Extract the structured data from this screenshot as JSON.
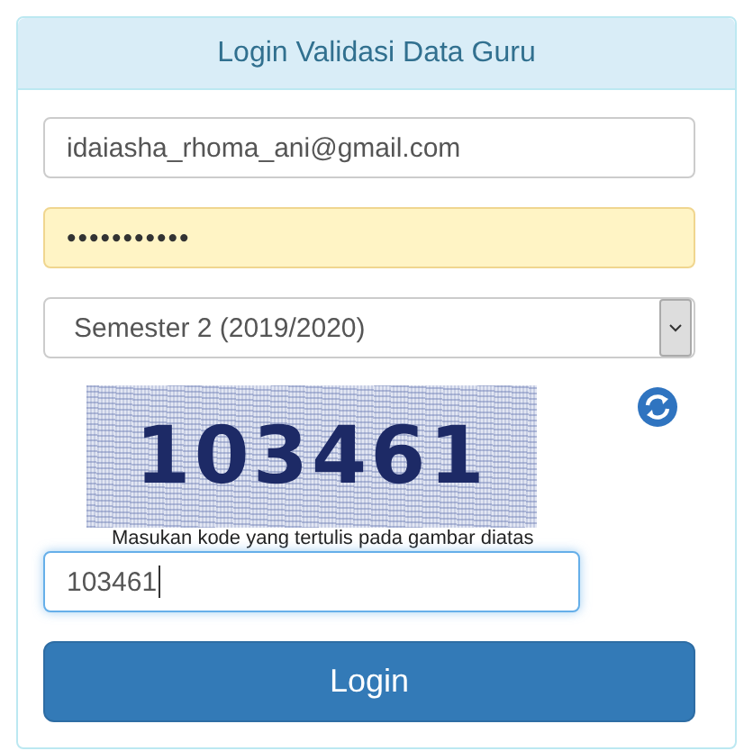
{
  "panel": {
    "title": "Login Validasi Data Guru"
  },
  "email": {
    "value": "idaiasha_rhoma_ani@gmail.com"
  },
  "password": {
    "value": "•••••••••••",
    "autofilled": true
  },
  "semester": {
    "value": "Semester 2 (2019/2020)"
  },
  "captcha": {
    "code": "103461",
    "hint": "Masukan kode yang tertulis pada gambar diatas"
  },
  "captcha_input": {
    "value": "103461",
    "focused": true
  },
  "login_button": {
    "label": "Login"
  }
}
